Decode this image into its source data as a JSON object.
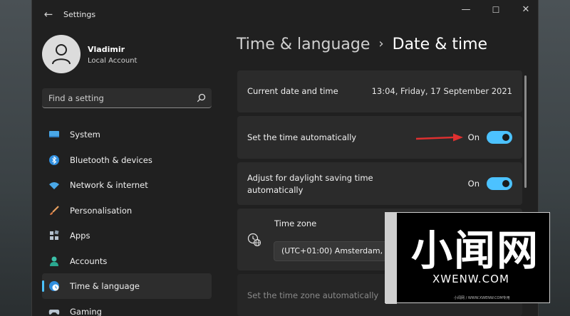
{
  "window": {
    "app_title": "Settings",
    "minimize": "—",
    "maximize": "☐",
    "close": "✕"
  },
  "profile": {
    "name": "Vladimir",
    "account_type": "Local Account"
  },
  "search": {
    "placeholder": "Find a setting"
  },
  "sidebar": {
    "items": [
      {
        "label": "System",
        "icon": "monitor-icon"
      },
      {
        "label": "Bluetooth & devices",
        "icon": "bluetooth-icon"
      },
      {
        "label": "Network & internet",
        "icon": "wifi-icon"
      },
      {
        "label": "Personalisation",
        "icon": "brush-icon"
      },
      {
        "label": "Apps",
        "icon": "apps-icon"
      },
      {
        "label": "Accounts",
        "icon": "person-icon"
      },
      {
        "label": "Time & language",
        "icon": "clock-globe-icon",
        "active": true
      },
      {
        "label": "Gaming",
        "icon": "gamepad-icon"
      }
    ]
  },
  "breadcrumb": {
    "parent": "Time & language",
    "separator": "›",
    "current": "Date & time"
  },
  "settings": {
    "current_date": {
      "label": "Current date and time",
      "value": "13:04, Friday, 17 September 2021"
    },
    "auto_time": {
      "label": "Set the time automatically",
      "state_text": "On",
      "on": true
    },
    "dst": {
      "label": "Adjust for daylight saving time automatically",
      "label_line1": "Adjust for daylight saving time",
      "label_line2": "automatically",
      "state_text": "On",
      "on": true
    },
    "time_zone": {
      "label": "Time zone",
      "selected": "(UTC+01:00) Amsterdam, Berlin, Bern, Rome, ..."
    },
    "auto_tz": {
      "label": "Set the time zone automatically"
    }
  },
  "watermark": {
    "big_text": "小闻网",
    "domain": "XWENW.COM",
    "small": "小闻网 / WWW.XWENW.COM专用",
    "side": "WWW.XWENW.COM"
  },
  "colors": {
    "accent": "#4cc2ff",
    "window_bg": "#202020",
    "card_bg": "#2b2b2b",
    "arrow": "#e03030"
  }
}
